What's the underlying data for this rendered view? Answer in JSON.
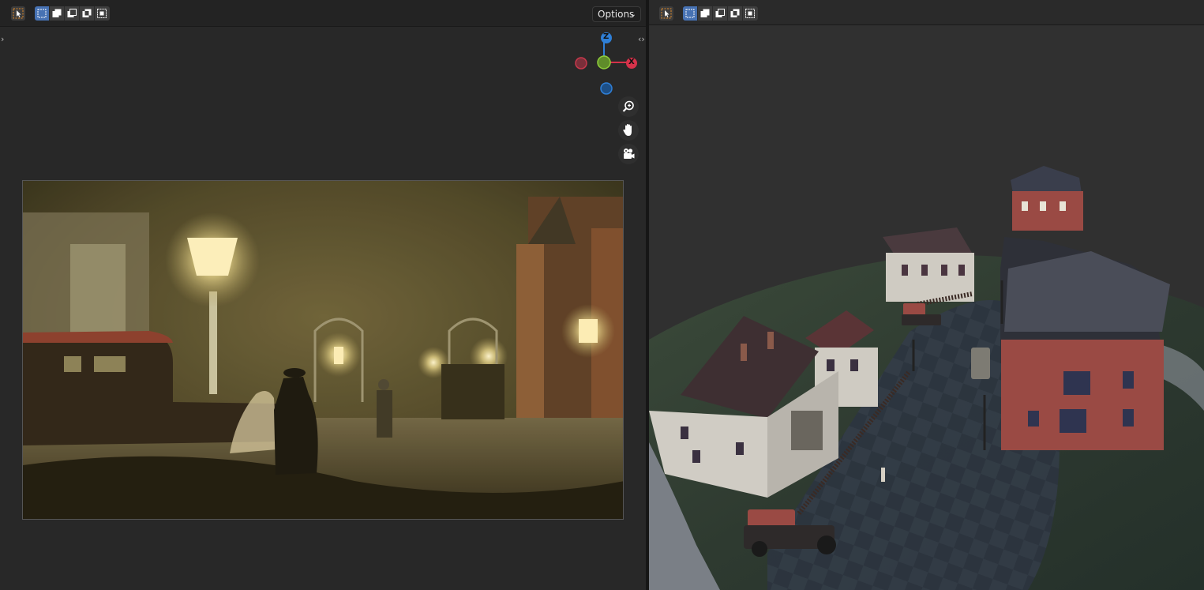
{
  "left_viewport": {
    "header": {
      "select_tool": "select-tool",
      "modes": [
        "select-new",
        "select-extend",
        "select-subtract",
        "select-invert",
        "select-intersect"
      ],
      "options_label": "Options",
      "options_chevron": "⌄"
    },
    "gizmo": {
      "z_label": "Z",
      "x_label": "X",
      "colors": {
        "x": "#d5324a",
        "y": "#7ab830",
        "z": "#2f7fd6"
      }
    },
    "nav_buttons": [
      "zoom-icon",
      "hand-pan-icon",
      "camera-icon"
    ],
    "edge_arrows": {
      "left": "›",
      "right": "‹›"
    }
  },
  "right_viewport": {
    "header": {
      "select_tool": "select-tool",
      "modes": [
        "select-new",
        "select-extend",
        "select-subtract",
        "select-invert",
        "select-intersect"
      ]
    }
  },
  "colors": {
    "accent": "#4772b3",
    "header_bg": "#232323",
    "viewport_bg": "#282828"
  }
}
